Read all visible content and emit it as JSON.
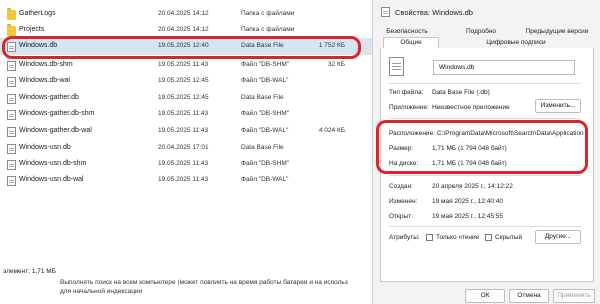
{
  "explorer": {
    "files": [
      {
        "name": "GatherLogs",
        "date": "20.04.2025 14:12",
        "type": "Папка с файлами",
        "size": "",
        "kind": "folder"
      },
      {
        "name": "Projects",
        "date": "20.04.2025 14:12",
        "type": "Папка с файлами",
        "size": "",
        "kind": "folder"
      },
      {
        "name": "Windows.db",
        "date": "19.05.2025 12:40",
        "type": "Data Base File",
        "size": "1 752 КБ",
        "kind": "file",
        "selected": true
      },
      {
        "name": "Windows.db-shm",
        "date": "19.05.2025 11:43",
        "type": "Файл \"DB-SHM\"",
        "size": "32 КБ",
        "kind": "file"
      },
      {
        "name": "Windows.db-wal",
        "date": "19.05.2025 12:45",
        "type": "Файл \"DB-WAL\"",
        "size": "",
        "kind": "file"
      },
      {
        "name": "Windows-gather.db",
        "date": "19.05.2025 12:45",
        "type": "Data Base File",
        "size": "",
        "kind": "file"
      },
      {
        "name": "Windows-gather.db-shm",
        "date": "19.05.2025 11:43",
        "type": "Файл \"DB-SHM\"",
        "size": "",
        "kind": "file"
      },
      {
        "name": "Windows-gather.db-wal",
        "date": "19.05.2025 11:43",
        "type": "Файл \"DB-WAL\"",
        "size": "4 024 КБ",
        "kind": "file"
      },
      {
        "name": "Windows-usn.db",
        "date": "20.04.2025 17:01",
        "type": "Data Base File",
        "size": "",
        "kind": "file"
      },
      {
        "name": "Windows-usn.db-shm",
        "date": "19.05.2025 11:43",
        "type": "Файл \"DB-SHM\"",
        "size": "",
        "kind": "file"
      },
      {
        "name": "Windows-usn.db-wal",
        "date": "19.05.2025 11:43",
        "type": "Файл \"DB-WAL\"",
        "size": "",
        "kind": "file"
      }
    ],
    "status_text": "элемент: 1,71 МБ",
    "tooltip_line1": "Выполнять поиск на всем компьютере (может повлиять на время работы батареи и на использ",
    "tooltip_line2": "для начальной индексации"
  },
  "dialog": {
    "title": "Свойства: Windows.db",
    "tabs_top": [
      "Безопасность",
      "Подробно",
      "Предыдущие версии"
    ],
    "tabs_bottom": [
      "Общие",
      "Цифровые подписи"
    ],
    "file_name_value": "Windows.db",
    "type_label": "Тип файла:",
    "type_value": "Data Base File (.db)",
    "app_label": "Приложение:",
    "app_value": "Неизвестное приложение",
    "change_button": "Изменить...",
    "location_label": "Расположение:",
    "location_value": "C:\\ProgramData\\Microsoft\\Search\\Data\\Application",
    "size_label": "Размер:",
    "size_value": "1,71 МБ (1 794 048 байт)",
    "disk_label": "На диске:",
    "disk_value": "1,71 МБ (1 794 048 байт)",
    "created_label": "Создан:",
    "created_value": "20 апреля 2025 г., 14:12:22",
    "modified_label": "Изменен:",
    "modified_value": "19 мая 2025 г., 12:40:40",
    "opened_label": "Открыт:",
    "opened_value": "19 мая 2025 г., 12:45:55",
    "attributes_label": "Атрибуты:",
    "readonly_label": "Только чтение",
    "hidden_label": "Скрытый",
    "other_button": "Другие...",
    "ok_button": "ОК",
    "cancel_button": "Отмена",
    "apply_button": "Применить"
  },
  "colors": {
    "highlight_box": "#d9262a",
    "selected_row": "#d9e4f3",
    "folder": "#f3c744"
  }
}
